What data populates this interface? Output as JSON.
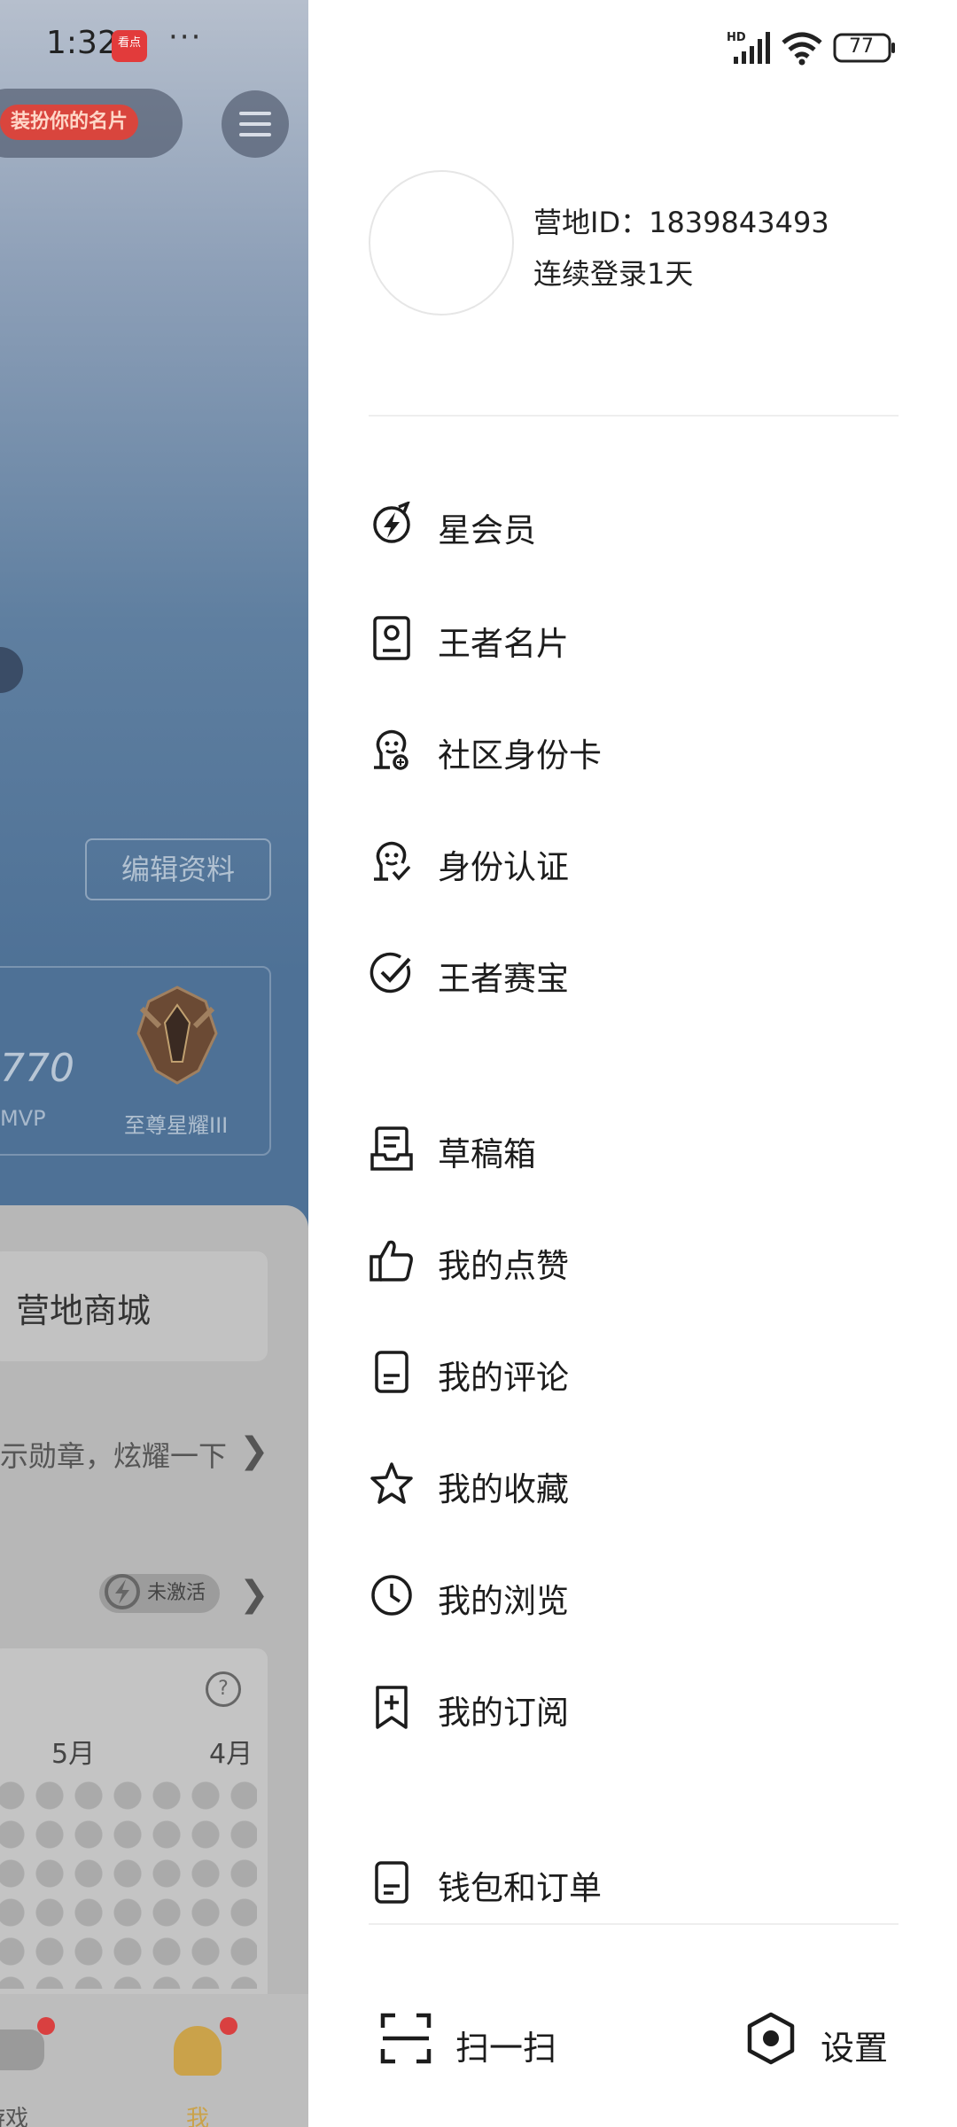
{
  "status_bar": {
    "time": "1:32",
    "app_badge": "看点",
    "more": "···",
    "network": "HD",
    "battery": "77"
  },
  "background": {
    "dress_up_tag": "装扮你的名片",
    "edit_profile": "编辑资料",
    "stat_value": "770",
    "stat_label": "MVP",
    "rank_label": "至尊星耀III",
    "shop_label": "营地商城",
    "medal_text": "示勋章，炫耀一下",
    "inactive_label": "未激活",
    "months": [
      "5月",
      "4月"
    ],
    "nav": {
      "game": "游戏",
      "me": "我"
    }
  },
  "drawer": {
    "profile": {
      "camp_id": "营地ID：1839843493",
      "login_streak": "连续登录1天"
    },
    "menu": [
      {
        "label": "星会员",
        "icon": "star-member-icon"
      },
      {
        "label": "王者名片",
        "icon": "name-card-icon"
      },
      {
        "label": "社区身份卡",
        "icon": "community-id-icon"
      },
      {
        "label": "身份认证",
        "icon": "verify-identity-icon"
      },
      {
        "label": "王者赛宝",
        "icon": "match-treasure-icon"
      },
      {
        "label": "草稿箱",
        "icon": "drafts-icon"
      },
      {
        "label": "我的点赞",
        "icon": "thumbs-up-icon"
      },
      {
        "label": "我的评论",
        "icon": "comment-doc-icon"
      },
      {
        "label": "我的收藏",
        "icon": "star-outline-icon"
      },
      {
        "label": "我的浏览",
        "icon": "clock-icon"
      },
      {
        "label": "我的订阅",
        "icon": "bookmark-plus-icon"
      },
      {
        "label": "钱包和订单",
        "icon": "wallet-doc-icon"
      }
    ],
    "bottom": {
      "scan_label": "扫一扫",
      "settings_label": "设置"
    }
  }
}
